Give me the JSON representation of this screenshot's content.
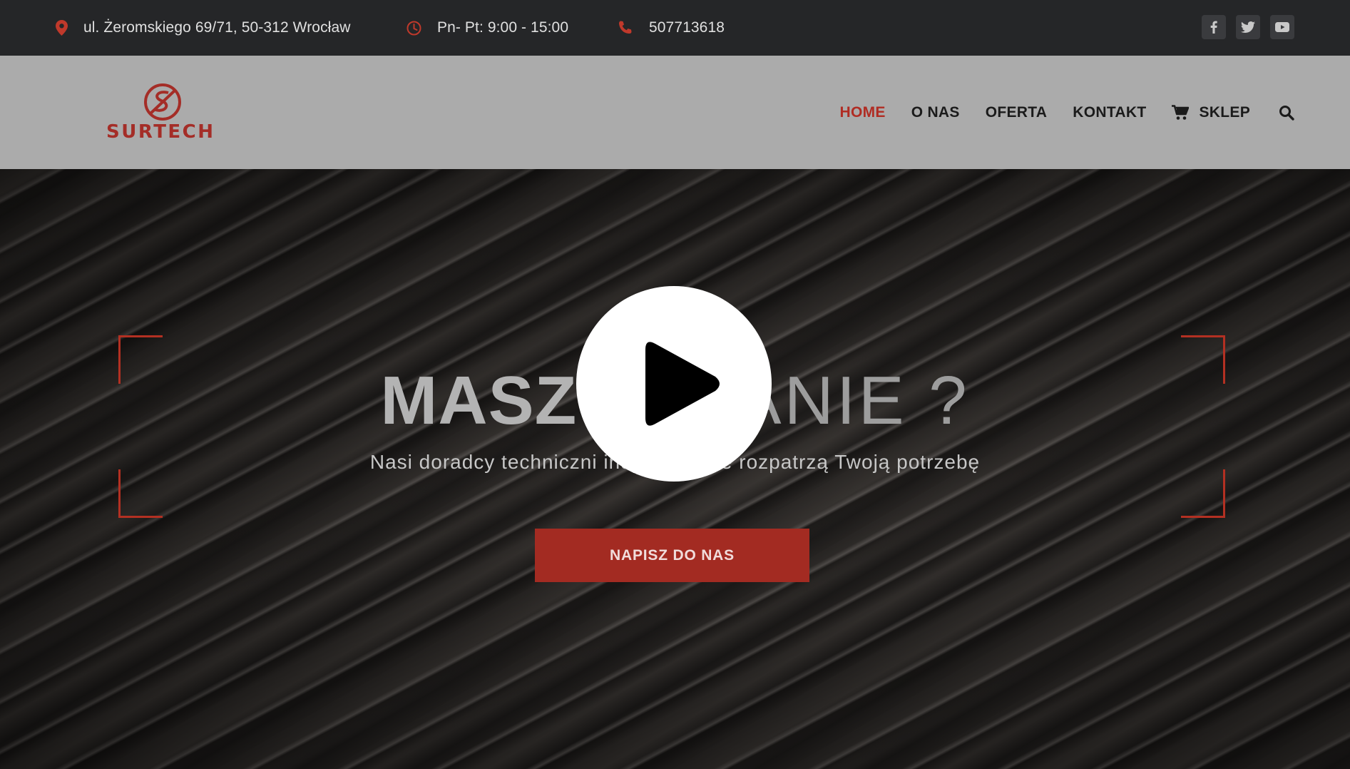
{
  "topbar": {
    "address": "ul. Żeromskiego 69/71, 50-312 Wrocław",
    "hours": "Pn- Pt: 9:00 - 15:00",
    "phone": "507713618",
    "social": [
      "facebook-icon",
      "twitter-icon",
      "youtube-icon"
    ]
  },
  "header": {
    "logo_text": "SURTECH",
    "nav": {
      "home": "HOME",
      "about": "O NAS",
      "offer": "OFERTA",
      "contact": "KONTAKT",
      "shop": "SKLEP"
    }
  },
  "hero": {
    "headline_bold": "MASZ",
    "headline_thin": " PYTANIE ?",
    "subline": "Nasi doradcy techniczni indywidualnie rozpatrzą Twoją potrzebę",
    "cta": "NAPISZ DO NAS"
  },
  "colors": {
    "accent": "#a32b22",
    "topbar_bg": "#252628",
    "header_bg": "#ababab"
  }
}
